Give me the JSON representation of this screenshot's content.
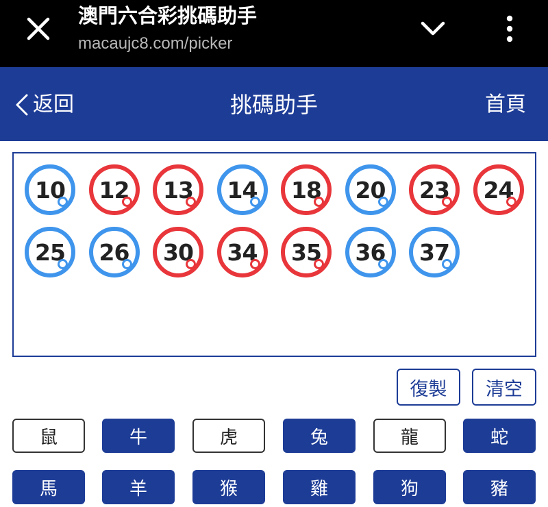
{
  "browser": {
    "title": "澳門六合彩挑碼助手",
    "url": "macaujc8.com/picker",
    "close_icon": "close-icon",
    "expand_icon": "chevron-down-icon",
    "menu_icon": "more-vertical-icon"
  },
  "header": {
    "back_label": "返回",
    "title": "挑碼助手",
    "home_label": "首頁"
  },
  "selected_numbers": [
    {
      "number": "10",
      "color": "blue"
    },
    {
      "number": "12",
      "color": "red"
    },
    {
      "number": "13",
      "color": "red"
    },
    {
      "number": "14",
      "color": "blue"
    },
    {
      "number": "18",
      "color": "red"
    },
    {
      "number": "20",
      "color": "blue"
    },
    {
      "number": "23",
      "color": "red"
    },
    {
      "number": "24",
      "color": "red"
    },
    {
      "number": "25",
      "color": "blue"
    },
    {
      "number": "26",
      "color": "blue"
    },
    {
      "number": "30",
      "color": "red"
    },
    {
      "number": "34",
      "color": "red"
    },
    {
      "number": "35",
      "color": "red"
    },
    {
      "number": "36",
      "color": "blue"
    },
    {
      "number": "37",
      "color": "blue"
    }
  ],
  "actions": {
    "copy_label": "復製",
    "clear_label": "清空"
  },
  "zodiac": [
    {
      "label": "鼠",
      "selected": false
    },
    {
      "label": "牛",
      "selected": true
    },
    {
      "label": "虎",
      "selected": false
    },
    {
      "label": "兔",
      "selected": true
    },
    {
      "label": "龍",
      "selected": false
    },
    {
      "label": "蛇",
      "selected": true
    },
    {
      "label": "馬",
      "selected": true
    },
    {
      "label": "羊",
      "selected": true
    },
    {
      "label": "猴",
      "selected": true
    },
    {
      "label": "雞",
      "selected": true
    },
    {
      "label": "狗",
      "selected": true
    },
    {
      "label": "豬",
      "selected": true
    }
  ],
  "colors": {
    "brand": "#1d3c96",
    "ball_red": "#e8363b",
    "ball_blue": "#3f95ec"
  }
}
